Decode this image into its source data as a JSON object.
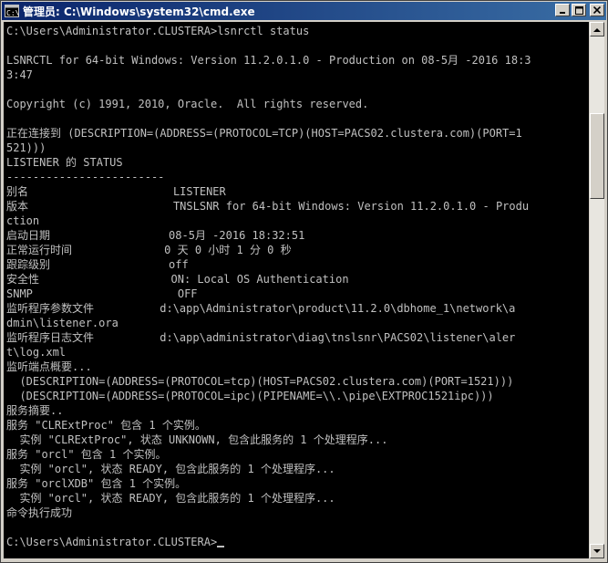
{
  "window": {
    "title": "管理员: C:\\Windows\\system32\\cmd.exe"
  },
  "console": {
    "lines": [
      "C:\\Users\\Administrator.CLUSTERA>lsnrctl status",
      "",
      "LSNRCTL for 64-bit Windows: Version 11.2.0.1.0 - Production on 08-5月 -2016 18:3",
      "3:47",
      "",
      "Copyright (c) 1991, 2010, Oracle.  All rights reserved.",
      "",
      "正在连接到 (DESCRIPTION=(ADDRESS=(PROTOCOL=TCP)(HOST=PACS02.clustera.com)(PORT=1",
      "521)))",
      "LISTENER 的 STATUS",
      "------------------------",
      "别名                      LISTENER",
      "版本                      TNSLSNR for 64-bit Windows: Version 11.2.0.1.0 - Produ",
      "ction",
      "启动日期                  08-5月 -2016 18:32:51",
      "正常运行时间              0 天 0 小时 1 分 0 秒",
      "跟踪级别                  off",
      "安全性                    ON: Local OS Authentication",
      "SNMP                      OFF",
      "监听程序参数文件          d:\\app\\Administrator\\product\\11.2.0\\dbhome_1\\network\\a",
      "dmin\\listener.ora",
      "监听程序日志文件          d:\\app\\administrator\\diag\\tnslsnr\\PACS02\\listener\\aler",
      "t\\log.xml",
      "监听端点概要...",
      "  (DESCRIPTION=(ADDRESS=(PROTOCOL=tcp)(HOST=PACS02.clustera.com)(PORT=1521)))",
      "  (DESCRIPTION=(ADDRESS=(PROTOCOL=ipc)(PIPENAME=\\\\.\\pipe\\EXTPROC1521ipc)))",
      "服务摘要..",
      "服务 \"CLRExtProc\" 包含 1 个实例。",
      "  实例 \"CLRExtProc\", 状态 UNKNOWN, 包含此服务的 1 个处理程序...",
      "服务 \"orcl\" 包含 1 个实例。",
      "  实例 \"orcl\", 状态 READY, 包含此服务的 1 个处理程序...",
      "服务 \"orclXDB\" 包含 1 个实例。",
      "  实例 \"orcl\", 状态 READY, 包含此服务的 1 个处理程序...",
      "命令执行成功",
      "",
      "C:\\Users\\Administrator.CLUSTERA>"
    ]
  }
}
